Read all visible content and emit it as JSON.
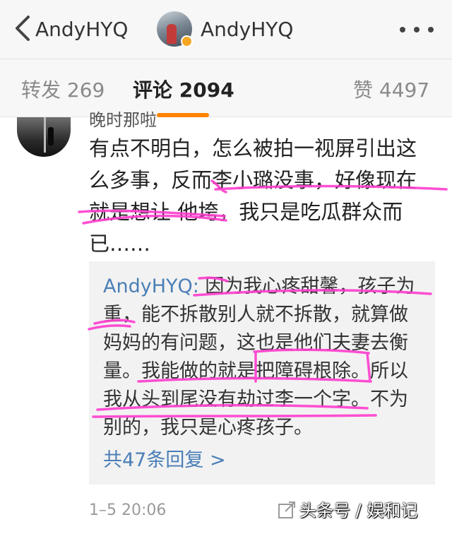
{
  "header": {
    "back_label": "AndyHYQ",
    "title": "AndyHYQ"
  },
  "tabs": [
    {
      "label": "转发 269"
    },
    {
      "label": "评论 2094",
      "active": true
    },
    {
      "label": "赞 4497"
    }
  ],
  "comment": {
    "author_clipped": "晚时那啦",
    "text": "有点不明白，怎么被拍一视屏引出这么多事，反而李小璐没事，好像现在就是想让 他垮，我只是吃瓜群众而已……",
    "reply": {
      "author": "AndyHYQ:",
      "text": " 因为我心疼甜馨，孩子为重，能不拆散别人就不拆散，就算做妈妈的有问题，这也是他们夫妻去衡量。我能做的就是把障碍根除。所以我从头到尾没有劫过李一个字。不为别的，我只是心疼孩子。",
      "more_label": "共47条回复 >"
    },
    "time": "1–5 20:06"
  },
  "watermark": "头条号 / 娱和记",
  "colors": {
    "accent_orange": "#ff8200",
    "link_blue": "#4b7fb6",
    "annotation_pink": "#ff3ccf",
    "verified_badge": "#f5a623"
  }
}
